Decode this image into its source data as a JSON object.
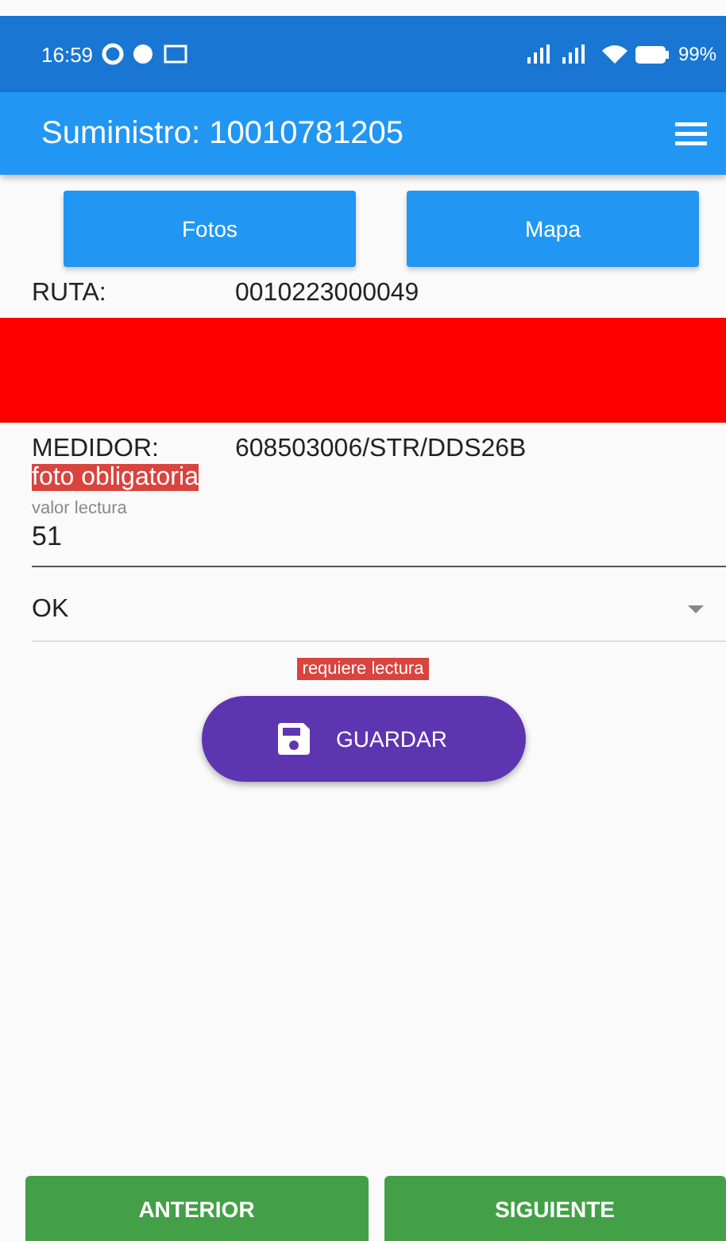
{
  "status_bar": {
    "time": "16:59",
    "battery": "99%"
  },
  "app_bar": {
    "title": "Suministro: 10010781205"
  },
  "top_buttons": [
    {
      "label": "Fotos"
    },
    {
      "label": "Mapa"
    }
  ],
  "ruta": {
    "label": "RUTA:",
    "value": "0010223000049"
  },
  "alert_band": {
    "color": "#ff0000"
  },
  "medidor": {
    "label": "MEDIDOR:",
    "value": "608503006/STR/DDS26B"
  },
  "photo_warning": "foto obligatoria",
  "reading_field": {
    "label": "valor lectura",
    "value": "51"
  },
  "status_select": {
    "value": "OK"
  },
  "reading_warning": "requiere lectura",
  "save_button": {
    "label": "GUARDAR"
  },
  "nav_buttons": [
    {
      "label": "ANTERIOR"
    },
    {
      "label": "SIGUIENTE"
    }
  ]
}
